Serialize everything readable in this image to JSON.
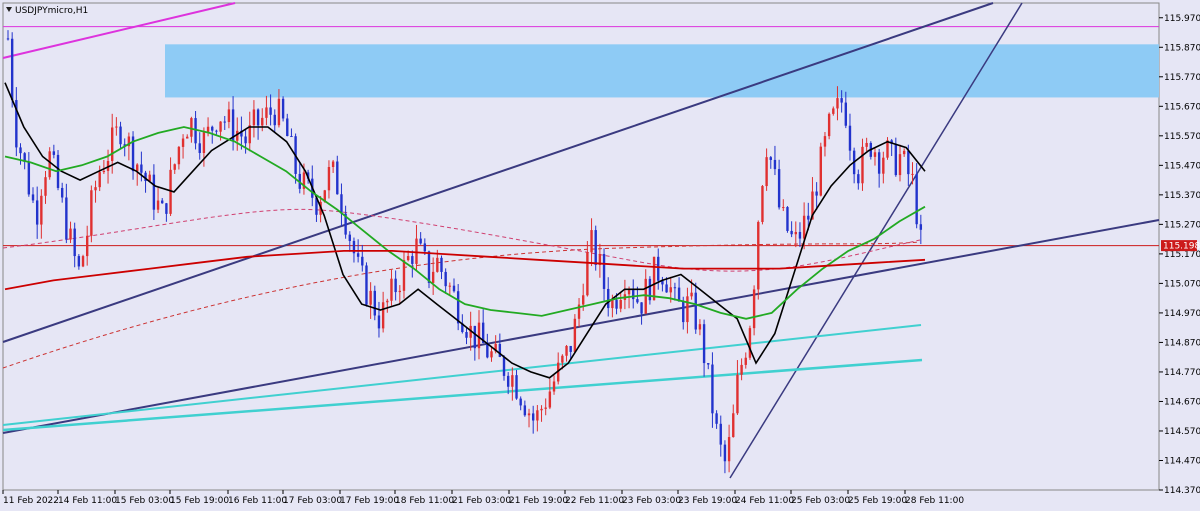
{
  "chart_data": {
    "type": "candlestick",
    "title": "USDJPYmicro,H1",
    "current_price_label": "115.198",
    "current_price": 115.198,
    "ylim": [
      114.37,
      116.02
    ],
    "y_ticks": [
      "115.970",
      "115.870",
      "115.770",
      "115.670",
      "115.570",
      "115.470",
      "115.370",
      "115.270",
      "115.170",
      "115.070",
      "114.970",
      "114.870",
      "114.770",
      "114.670",
      "114.570",
      "114.470",
      "114.370"
    ],
    "x_ticks": [
      "11 Feb 2022",
      "14 Feb 11:00",
      "15 Feb 03:00",
      "15 Feb 19:00",
      "16 Feb 11:00",
      "17 Feb 03:00",
      "17 Feb 19:00",
      "18 Feb 11:00",
      "21 Feb 03:00",
      "21 Feb 19:00",
      "22 Feb 11:00",
      "23 Feb 03:00",
      "23 Feb 19:00",
      "24 Feb 11:00",
      "25 Feb 03:00",
      "25 Feb 19:00",
      "28 Feb 11:00"
    ],
    "close_path": [
      115.9,
      115.6,
      115.5,
      115.4,
      115.3,
      115.45,
      115.5,
      115.4,
      115.3,
      115.2,
      115.1,
      115.2,
      115.35,
      115.45,
      115.5,
      115.55,
      115.6,
      115.55,
      115.5,
      115.45,
      115.4,
      115.35,
      115.3,
      115.4,
      115.5,
      115.6,
      115.62,
      115.58,
      115.55,
      115.6,
      115.65,
      115.62,
      115.6,
      115.58,
      115.55,
      115.6,
      115.62,
      115.64,
      115.66,
      115.62,
      115.55,
      115.45,
      115.4,
      115.38,
      115.35,
      115.4,
      115.45,
      115.4,
      115.3,
      115.2,
      115.1,
      115.05,
      115.0,
      114.95,
      115.0,
      115.05,
      115.1,
      115.15,
      115.2,
      115.15,
      115.1,
      115.15,
      115.1,
      115.05,
      115.0,
      114.95,
      114.9,
      114.88,
      114.85,
      114.82,
      114.8,
      114.78,
      114.75,
      114.7,
      114.65,
      114.6,
      114.65,
      114.7,
      114.75,
      114.8,
      114.85,
      114.95,
      115.1,
      115.2,
      115.15,
      115.05,
      115.0,
      115.05,
      115.1,
      115.05,
      115.0,
      115.05,
      115.1,
      115.12,
      115.08,
      115.0,
      114.98,
      115.0,
      114.95,
      114.85,
      114.7,
      114.55,
      114.45,
      114.55,
      114.75,
      114.85,
      115.0,
      115.35,
      115.55,
      115.45,
      115.3,
      115.25,
      115.2,
      115.25,
      115.3,
      115.4,
      115.5,
      115.6,
      115.65,
      115.7,
      115.55,
      115.45,
      115.5,
      115.55,
      115.5,
      115.52,
      115.48,
      115.5,
      115.45,
      115.4,
      115.2
    ],
    "moving_averages": [
      {
        "color": "#000000",
        "values": [
          115.75,
          115.6,
          115.5,
          115.45,
          115.42,
          115.45,
          115.48,
          115.45,
          115.4,
          115.38,
          115.45,
          115.52,
          115.56,
          115.6,
          115.6,
          115.55,
          115.45,
          115.3,
          115.1,
          115.0,
          114.98,
          115.0,
          115.05,
          115.0,
          114.95,
          114.9,
          114.85,
          114.8,
          114.77,
          114.75,
          114.8,
          114.9,
          115.0,
          115.05,
          115.05,
          115.08,
          115.1,
          115.05,
          115.0,
          114.95,
          114.8,
          114.9,
          115.1,
          115.3,
          115.4,
          115.47,
          115.52,
          115.55,
          115.53,
          115.45
        ]
      },
      {
        "color": "#22aa22",
        "values": [
          115.5,
          115.48,
          115.45,
          115.47,
          115.5,
          115.55,
          115.58,
          115.6,
          115.58,
          115.55,
          115.5,
          115.45,
          115.38,
          115.32,
          115.25,
          115.18,
          115.12,
          115.05,
          115.0,
          114.98,
          114.97,
          114.96,
          114.98,
          115.0,
          115.02,
          115.03,
          115.02,
          115.0,
          114.97,
          114.95,
          114.97,
          115.05,
          115.12,
          115.18,
          115.22,
          115.28,
          115.33
        ]
      },
      {
        "color": "#cc0000",
        "values": [
          115.05,
          115.08,
          115.1,
          115.12,
          115.14,
          115.16,
          115.17,
          115.18,
          115.18,
          115.17,
          115.16,
          115.15,
          115.14,
          115.13,
          115.12,
          115.12,
          115.12,
          115.13,
          115.14,
          115.15
        ]
      }
    ],
    "support_band": {
      "from": 115.7,
      "to": 115.88
    },
    "horizontal_level": 115.94
  }
}
